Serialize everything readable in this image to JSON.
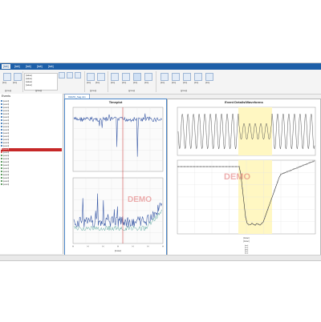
{
  "ribbon": {
    "tabs": [
      "[tab]",
      "[tab]",
      "[tab]",
      "[tab]",
      "[tab]"
    ],
    "active_tab_index": 0,
    "group_labels": [
      "[group]",
      "[group]",
      "[group]",
      "[group]",
      "[group]"
    ],
    "buttons": [
      "[btn]",
      "[btn]",
      "[btn]",
      "[btn]",
      "[btn]",
      "[btn]",
      "[btn]",
      "[btn]",
      "[btn]",
      "[btn]",
      "[btn]",
      "[btn]",
      "[btn]"
    ],
    "timeline_lines": [
      "[value]",
      "[value]",
      "[value]",
      "[value]"
    ]
  },
  "events_panel": {
    "title": "Events",
    "items": [
      {
        "text": "[event]",
        "color": "#1d5fa8"
      },
      {
        "text": "[event]",
        "color": "#1d5fa8"
      },
      {
        "text": "[event]",
        "color": "#1d5fa8"
      },
      {
        "text": "[event]",
        "color": "#1d5fa8"
      },
      {
        "text": "[event]",
        "color": "#1d5fa8"
      },
      {
        "text": "[event]",
        "color": "#1d5fa8"
      },
      {
        "text": "[event]",
        "color": "#1d5fa8"
      },
      {
        "text": "[event]",
        "color": "#1d5fa8"
      },
      {
        "text": "[event]",
        "color": "#1d5fa8"
      },
      {
        "text": "[event]",
        "color": "#1d5fa8"
      },
      {
        "text": "[event]",
        "color": "#1d5fa8"
      },
      {
        "text": "[event]",
        "color": "#1d5fa8"
      },
      {
        "text": "[event]",
        "color": "#1d5fa8"
      },
      {
        "text": "[event]",
        "color": "#1d5fa8"
      },
      {
        "text": "[event]",
        "color": "#1d5fa8"
      },
      {
        "text": "[event]",
        "color": "#c62828",
        "selected": true
      },
      {
        "text": "[event]",
        "color": "#c62828"
      },
      {
        "text": "[event]",
        "color": "#2e7d32"
      },
      {
        "text": "[event]",
        "color": "#2e7d32"
      },
      {
        "text": "[event]",
        "color": "#2e7d32"
      },
      {
        "text": "[event]",
        "color": "#2e7d32"
      },
      {
        "text": "[event]",
        "color": "#2e7d32"
      },
      {
        "text": "[event]",
        "color": "#2e7d32"
      },
      {
        "text": "[event]",
        "color": "#2e7d32"
      },
      {
        "text": "[event]",
        "color": "#2e7d32"
      },
      {
        "text": "[event]",
        "color": "#2e7d32"
      },
      {
        "text": "[event]",
        "color": "#2e7d32"
      }
    ]
  },
  "document_tab": "DEMO_Sag.dx1",
  "timeplot": {
    "title": "Timeplot",
    "watermark": "DEMO",
    "footer": "[footer]",
    "x_ticks": [
      "[x]",
      "[x]",
      "[x]",
      "[x]",
      "[x]",
      "[x]",
      "[x]"
    ]
  },
  "event_details": {
    "title": "Event Details/Waveforms",
    "watermark": "DEMO",
    "footer_lines": [
      "[footer]",
      "[footer]"
    ],
    "table_rows": [
      "[row]",
      "[row]",
      "[row]",
      "[row]",
      "[row]"
    ]
  },
  "colors": {
    "accent": "#1d5fa8",
    "selected": "#c62828",
    "trace_blue": "#3b5ba7",
    "highlight": "#fff7c2",
    "watermark": "#e06c6c"
  }
}
